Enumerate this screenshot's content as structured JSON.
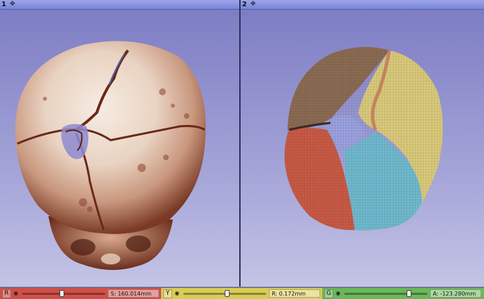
{
  "views": [
    {
      "number": "1",
      "pin_icon": "pin-icon",
      "content": "volume-rendering-skull"
    },
    {
      "number": "2",
      "pin_icon": "pin-icon",
      "content": "segmented-skull-model"
    }
  ],
  "slice_controllers": [
    {
      "letter": "R",
      "offset": "S: 160.014mm",
      "color": "#d0504a",
      "level": 0.45
    },
    {
      "letter": "Y",
      "offset": "R: 0.172mm",
      "color": "#d9cc56",
      "level": 0.5
    },
    {
      "letter": "G",
      "offset": "A: -123.280mm",
      "color": "#6ab85a",
      "level": 0.75
    }
  ],
  "segment_colors": {
    "frontal_left": "#c65a45",
    "frontal_right": "#6fb8cc",
    "parietal_right": "#d8c87a",
    "parietal_left": "#8a6a52",
    "fontanelle": "#9aa0dd"
  }
}
